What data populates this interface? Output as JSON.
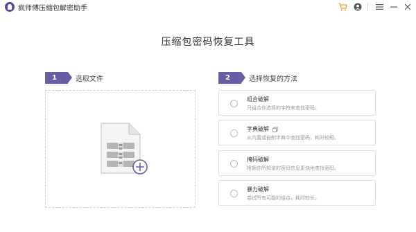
{
  "app": {
    "title": "疯师傅压缩包解密助手"
  },
  "titlebar": {
    "icons": [
      "cart-icon",
      "user-icon",
      "menu-icon",
      "minimize-icon",
      "close-icon"
    ]
  },
  "main": {
    "title": "压缩包密码恢复工具"
  },
  "step1": {
    "number": "1",
    "label": "选取文件"
  },
  "step2": {
    "number": "2",
    "label": "选择恢复的方法"
  },
  "methods": [
    {
      "name": "组合破解",
      "desc": "只组合你选择的字符来查找密码。"
    },
    {
      "name": "字典破解",
      "desc": "从内置或自制字典中查找密码，耗时较短。"
    },
    {
      "name": "掩码破解",
      "desc": "根据你所知道的密码信息更快地查找密码。"
    },
    {
      "name": "暴力破解",
      "desc": "尝试所有可能的组合，耗时较长。"
    }
  ],
  "colors": {
    "accent": "#6b5ca5",
    "cart": "#f0a020"
  }
}
